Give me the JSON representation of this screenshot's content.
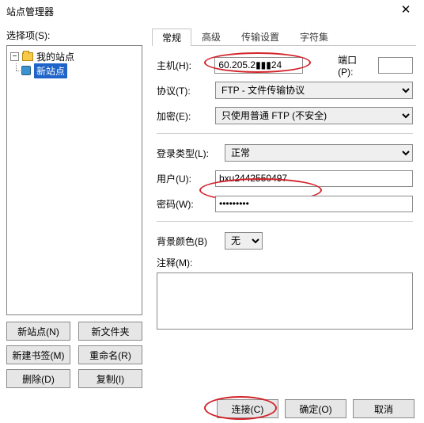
{
  "window": {
    "title": "站点管理器",
    "close_glyph": "✕"
  },
  "left": {
    "select_label": "选择项(S):",
    "root_label": "我的站点",
    "expander_glyph": "−",
    "site_label": "新站点",
    "buttons": {
      "new_site": "新站点(N)",
      "new_folder": "新文件夹",
      "new_bookmark": "新建书签(M)",
      "rename": "重命名(R)",
      "delete": "删除(D)",
      "copy": "复制(I)"
    }
  },
  "tabs": {
    "general": "常规",
    "advanced": "高级",
    "transfer": "传输设置",
    "charset": "字符集"
  },
  "form": {
    "host_label": "主机(H):",
    "host_value": "60.205.2▮▮▮24",
    "port_label": "端口(P):",
    "port_value": "",
    "protocol_label": "协议(T):",
    "protocol_value": "FTP - 文件传输协议",
    "encryption_label": "加密(E):",
    "encryption_value": "只使用普通 FTP (不安全)",
    "logintype_label": "登录类型(L):",
    "logintype_value": "正常",
    "user_label": "用户(U):",
    "user_value": "bxu2442550497",
    "password_label": "密码(W):",
    "password_value": "•••••••••",
    "bgcolor_label": "背景颜色(B)",
    "bgcolor_value": "无",
    "comment_label": "注释(M):",
    "comment_value": ""
  },
  "footer": {
    "connect": "连接(C)",
    "ok": "确定(O)",
    "cancel": "取消"
  }
}
